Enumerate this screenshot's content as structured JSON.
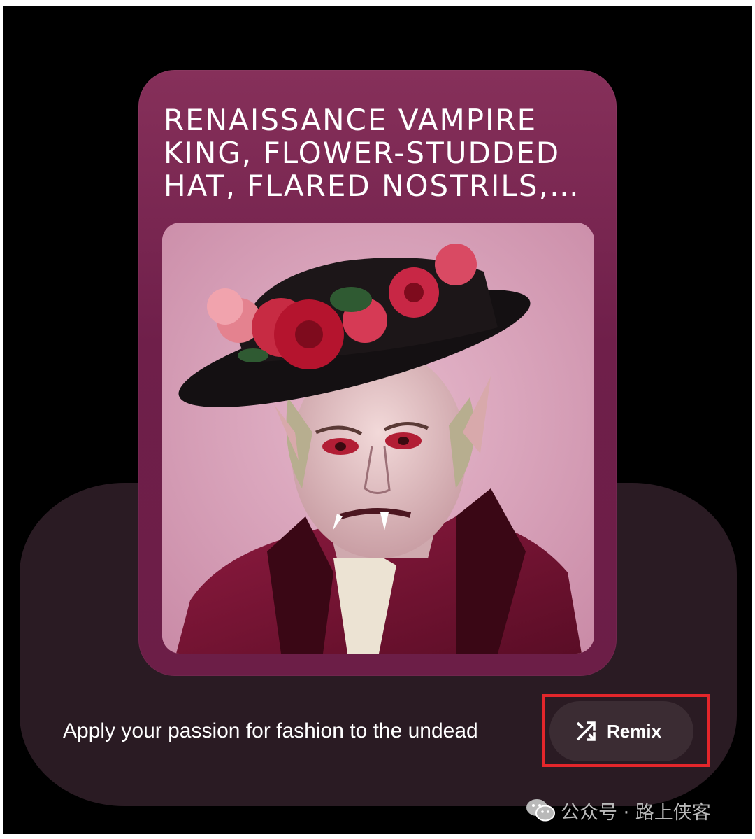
{
  "card": {
    "title": "RENAISSANCE VAMPIRE KING, FLOWER-STUDDED HAT, FLARED NOSTRILS,…",
    "image_label": "vampire-portrait"
  },
  "tagline": "Apply your passion for fashion to the undead",
  "remix": {
    "label": "Remix",
    "icon": "shuffle-icon"
  },
  "watermark": {
    "text": "公众号 · 路上侠客",
    "icon": "wechat-icon"
  },
  "colors": {
    "background": "#000000",
    "card": "#7a2450",
    "panel": "#2a1b23",
    "button": "#3b2c33",
    "highlight": "#e3262b"
  }
}
